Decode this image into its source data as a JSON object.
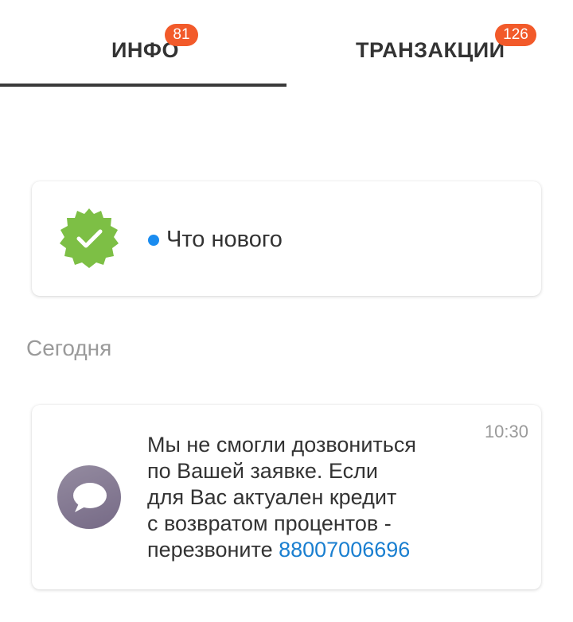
{
  "tabs": [
    {
      "label": "ИНФО",
      "badge": "81",
      "active": true
    },
    {
      "label": "ТРАНЗАКЦИИ",
      "badge": "126",
      "active": false
    }
  ],
  "whats_new": {
    "label": "Что нового",
    "icon": "verified-badge-icon",
    "icon_color": "#7dbf45",
    "dot_color": "#1a8cf0"
  },
  "section": {
    "date_label": "Сегодня"
  },
  "message": {
    "time": "10:30",
    "icon": "chat-bubble-icon",
    "lines": [
      "Мы не смогли дозвониться",
      "по Вашей заявке. Если",
      "для Вас актуален кредит",
      "с возвратом процентов -"
    ],
    "last_line_prefix": "перезвоните ",
    "phone": "88007006696"
  },
  "colors": {
    "badge": "#f25a2a",
    "link": "#1a7fd0",
    "active_underline": "#3a3a3a"
  }
}
